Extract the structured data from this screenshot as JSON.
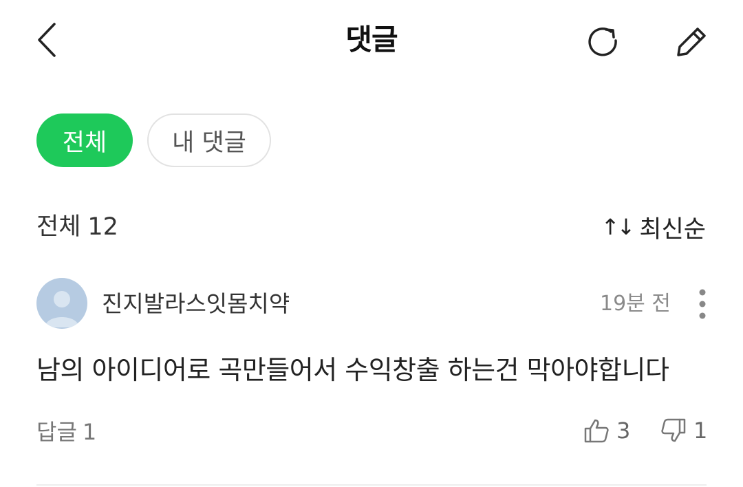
{
  "header": {
    "title": "댓글",
    "back_icon": "chevron-left-icon",
    "refresh_icon": "refresh-icon",
    "edit_icon": "pencil-icon"
  },
  "filters": {
    "all_label": "전체",
    "mine_label": "내 댓글",
    "active": "전체"
  },
  "summary": {
    "count_label": "전체",
    "count": "12",
    "sort_label": "최신순",
    "sort_icon": "↑↓"
  },
  "comment": {
    "author": "진지발라스잇몸치약",
    "time": "19분 전",
    "text": "남의 아이디어로 곡만들어서 수익창출 하는건 막아야합니다",
    "reply_label": "답글",
    "reply_count": "1",
    "likes": "3",
    "dislikes": "1"
  },
  "colors": {
    "accent": "#1ec95a",
    "avatar": "#b6cbe2",
    "muted": "#8a8a8a"
  }
}
